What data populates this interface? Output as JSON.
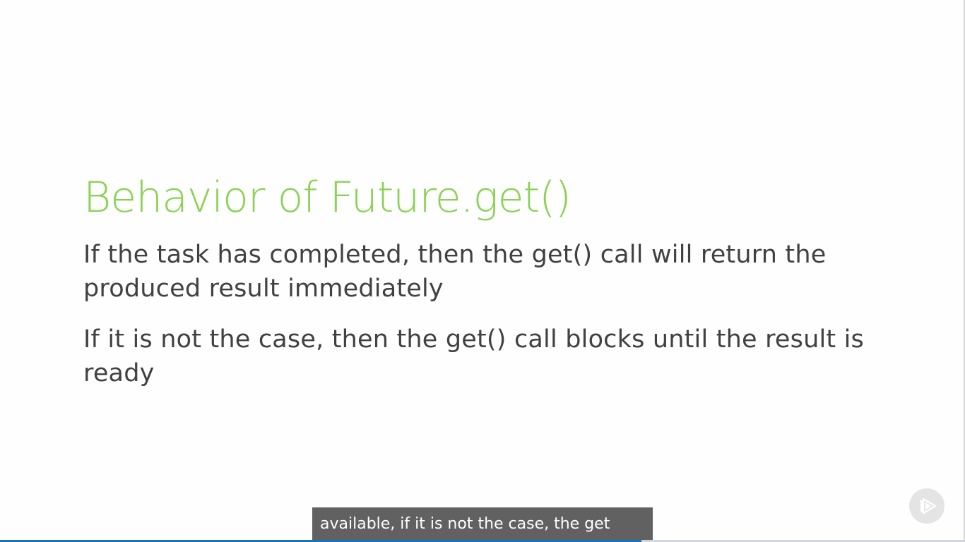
{
  "slide": {
    "title": "Behavior of Future.get()",
    "bullets": [
      "If the task has completed, then the get() call will return the produced result immediately",
      "If it is not the case, then the get() call blocks until the result is ready"
    ]
  },
  "player": {
    "caption": "available, if it is not the case, the get",
    "progress_fraction": 0.665,
    "play_icon": "pluralsight-play-icon"
  },
  "colors": {
    "title": "#8ad253",
    "body_text": "#414042",
    "caption_bg": "#616161",
    "progress": "#1a73b5"
  }
}
